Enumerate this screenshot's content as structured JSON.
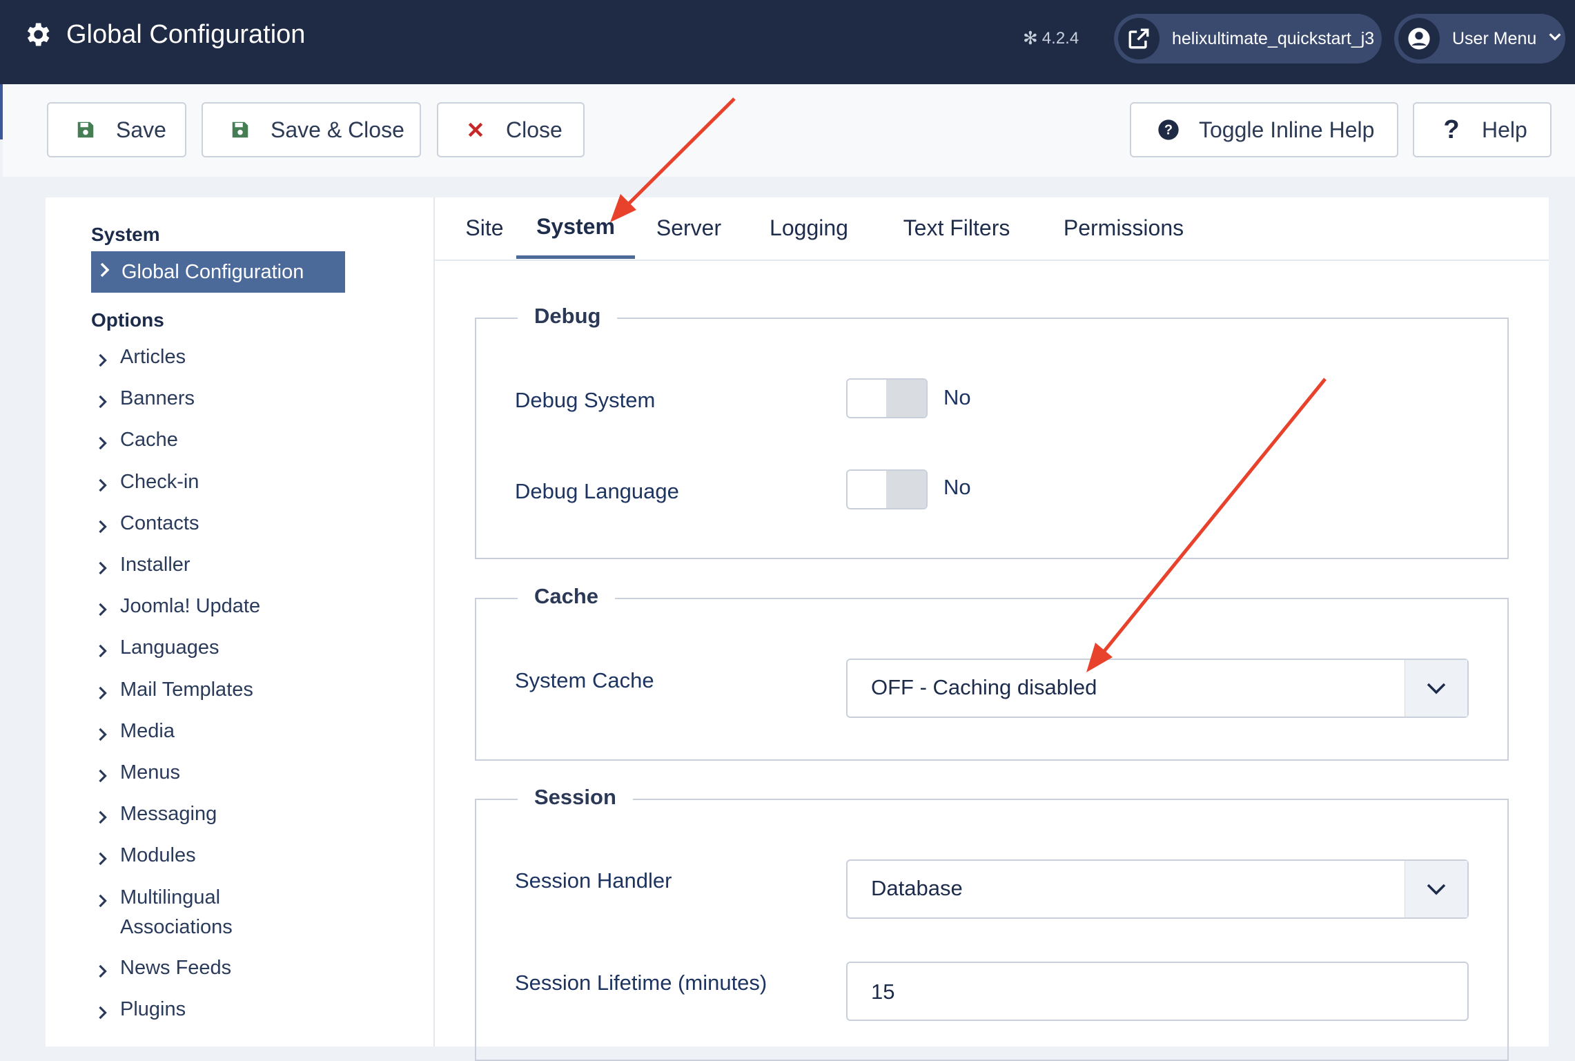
{
  "header": {
    "title": "Global Configuration",
    "version": "4.2.4",
    "site_link": "helixultimate_quickstart_j3",
    "user_menu": "User Menu"
  },
  "toolbar": {
    "save": "Save",
    "save_close": "Save & Close",
    "close": "Close",
    "toggle_help": "Toggle Inline Help",
    "help": "Help"
  },
  "sidebar": {
    "system_heading": "System",
    "active_item": "Global Configuration",
    "options_heading": "Options",
    "items": [
      "Articles",
      "Banners",
      "Cache",
      "Check-in",
      "Contacts",
      "Installer",
      "Joomla! Update",
      "Languages",
      "Mail Templates",
      "Media",
      "Menus",
      "Messaging",
      "Modules",
      "Multilingual Associations",
      "News Feeds",
      "Plugins"
    ]
  },
  "tabs": [
    "Site",
    "System",
    "Server",
    "Logging",
    "Text Filters",
    "Permissions"
  ],
  "active_tab": "System",
  "debug": {
    "legend": "Debug",
    "debug_system_label": "Debug System",
    "debug_system_value": "No",
    "debug_language_label": "Debug Language",
    "debug_language_value": "No"
  },
  "cache": {
    "legend": "Cache",
    "system_cache_label": "System Cache",
    "system_cache_value": "OFF - Caching disabled"
  },
  "session": {
    "legend": "Session",
    "handler_label": "Session Handler",
    "handler_value": "Database",
    "lifetime_label": "Session Lifetime (minutes)",
    "lifetime_value": "15"
  },
  "colors": {
    "header_bg": "#1f2a44",
    "accent": "#4b6999",
    "annotation_arrow": "#e8412c",
    "save_icon": "#457d54",
    "close_icon": "#c52827"
  }
}
